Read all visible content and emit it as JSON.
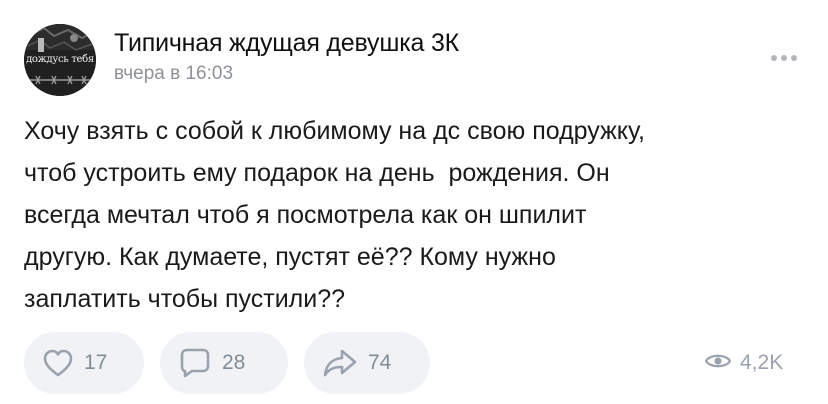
{
  "post": {
    "author": "Типичная ждущая девушка 3К",
    "time": "вчера в 16:03",
    "avatar_text": "дождусь тебя",
    "text_lines": [
      "Хочу взять с собой к любимому на дс свою подружку,",
      "чтоб устроить ему подарок на день  рождения. Он",
      "всегда мечтал чтоб я посмотрела как он шпилит",
      "другую. Как думаете, пустят её?? Кому нужно",
      "заплатить чтобы пустили??"
    ]
  },
  "actions": {
    "likes": "17",
    "comments": "28",
    "shares": "74",
    "views": "4,2K"
  },
  "icons": {
    "more": "more-dots-icon",
    "like": "heart-icon",
    "comment": "comment-icon",
    "share": "share-arrow-icon",
    "views": "eye-icon"
  },
  "colors": {
    "icon": "#99a2ad",
    "count": "#818c99",
    "button_bg": "#f0f2f5",
    "secondary_text": "#8e9196"
  }
}
